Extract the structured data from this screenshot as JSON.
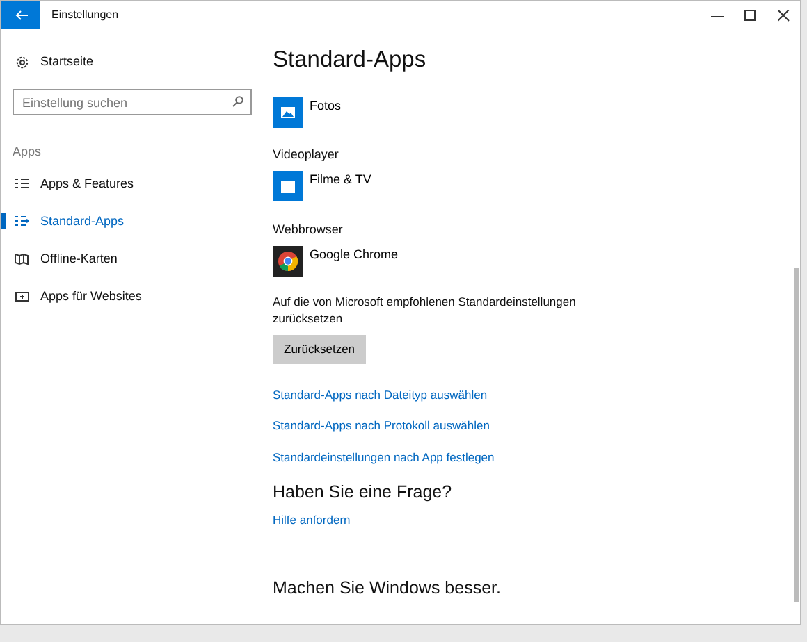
{
  "window": {
    "title": "Einstellungen"
  },
  "sidebar": {
    "home": "Startseite",
    "search": {
      "placeholder": "Einstellung suchen"
    },
    "section": "Apps",
    "items": [
      {
        "label": "Apps & Features",
        "selected": false
      },
      {
        "label": "Standard-Apps",
        "selected": true
      },
      {
        "label": "Offline-Karten",
        "selected": false
      },
      {
        "label": "Apps für Websites",
        "selected": false
      }
    ]
  },
  "page": {
    "title": "Standard-Apps",
    "groups": [
      {
        "app": "Fotos"
      },
      {
        "heading": "Videoplayer",
        "app": "Filme & TV"
      },
      {
        "heading": "Webbrowser",
        "app": "Google Chrome"
      }
    ],
    "reset_text": "Auf die von Microsoft empfohlenen Standardeinstellungen zurücksetzen",
    "reset_button": "Zurücksetzen",
    "links": [
      "Standard-Apps nach Dateityp auswählen",
      "Standard-Apps nach Protokoll auswählen",
      "Standardeinstellungen nach App festlegen"
    ],
    "question": "Haben Sie eine Frage?",
    "help_link": "Hilfe anfordern",
    "feedback": "Machen Sie Windows besser."
  }
}
